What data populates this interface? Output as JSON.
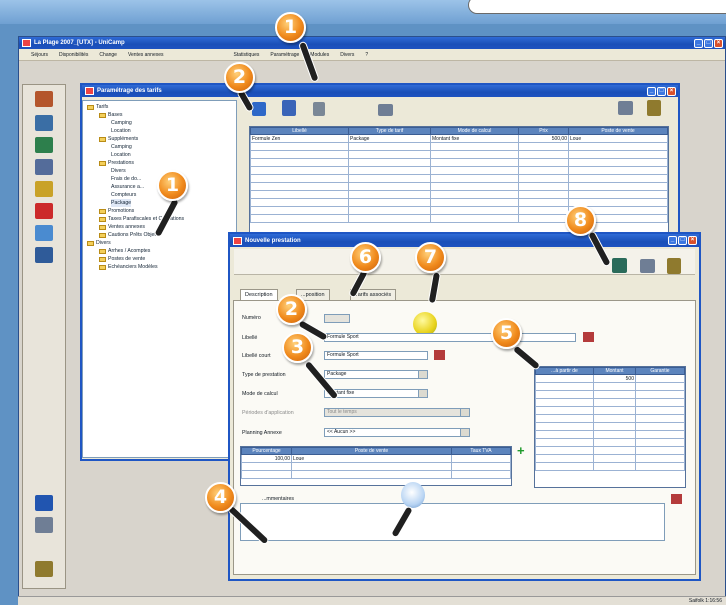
{
  "app": {
    "title": "La Plage 2007_[UTX] - UniCamp",
    "menu": [
      "Séjours",
      "Disponibilités",
      "Change",
      "Ventes annexes",
      "",
      "Statistiques",
      "Paramétrage",
      "Modules",
      "Divers",
      "?"
    ],
    "status": "Saifolk   1:16:56"
  },
  "params_window": {
    "title": "Paramétrage des tarifs",
    "tree": [
      {
        "label": "Tarifs",
        "level": 0
      },
      {
        "label": "Bases",
        "level": 1
      },
      {
        "label": "Camping",
        "level": 2
      },
      {
        "label": "Location",
        "level": 2
      },
      {
        "label": "Suppléments",
        "level": 1
      },
      {
        "label": "Camping",
        "level": 2
      },
      {
        "label": "Location",
        "level": 2
      },
      {
        "label": "Prestations",
        "level": 1
      },
      {
        "label": "Divers",
        "level": 2
      },
      {
        "label": "Frais de do...",
        "level": 2
      },
      {
        "label": "Assurance a...",
        "level": 2
      },
      {
        "label": "Compteurs",
        "level": 2
      },
      {
        "label": "Package",
        "level": 2
      },
      {
        "label": "Promotions",
        "level": 1
      },
      {
        "label": "Taxes Parafiscales et Cotisations",
        "level": 1
      },
      {
        "label": "Ventes annexes",
        "level": 1
      },
      {
        "label": "Cautions Prêts Objets",
        "level": 1
      },
      {
        "label": "Divers",
        "level": 0
      },
      {
        "label": "Arrhes / Acomptes",
        "level": 1
      },
      {
        "label": "Postes de vente",
        "level": 1
      },
      {
        "label": "Echéanciers Modèles",
        "level": 1
      }
    ],
    "grid": {
      "headers": [
        "Libellé",
        "Type de tarif",
        "Mode de calcul",
        "Prix",
        "Poste de vente"
      ],
      "rows": [
        [
          "Formule Zen",
          "Package",
          "Montant fixe",
          "500,00",
          "Loue"
        ]
      ]
    }
  },
  "np_window": {
    "title": "Nouvelle prestation",
    "tabs": [
      "Description",
      "...position",
      "Tarifs associés"
    ],
    "labels": {
      "numero": "Numéro",
      "libelle": "Libellé",
      "libelle_court": "Libellé court",
      "type": "Type de prestation",
      "mode": "Mode de calcul",
      "periodes": "Périodes d'application",
      "planning": "Planning Annexe",
      "commentaires": "...mmentaires"
    },
    "values": {
      "libelle": "Formule Sport",
      "libelle_court": "Formule Sport",
      "type": "Package",
      "mode": "Montant fixe",
      "periodes": "Tout le temps",
      "planning": "<< Aucun >>"
    },
    "poste_grid": {
      "headers": [
        "Pourcentage",
        "Poste de vente",
        "Taux TVA"
      ],
      "rows": [
        [
          "100,00",
          "Loue",
          ""
        ]
      ]
    },
    "price_grid": {
      "headers": [
        "...à partir de",
        "Montant",
        "Garantie"
      ],
      "rows": [
        [
          "",
          "500",
          ""
        ]
      ]
    }
  },
  "callouts": [
    "1",
    "2",
    "1",
    "2",
    "3",
    "4",
    "5",
    "6",
    "7",
    "8"
  ],
  "colors": {
    "accent": "#f08a1c",
    "title_bar": "#1f56c4"
  }
}
